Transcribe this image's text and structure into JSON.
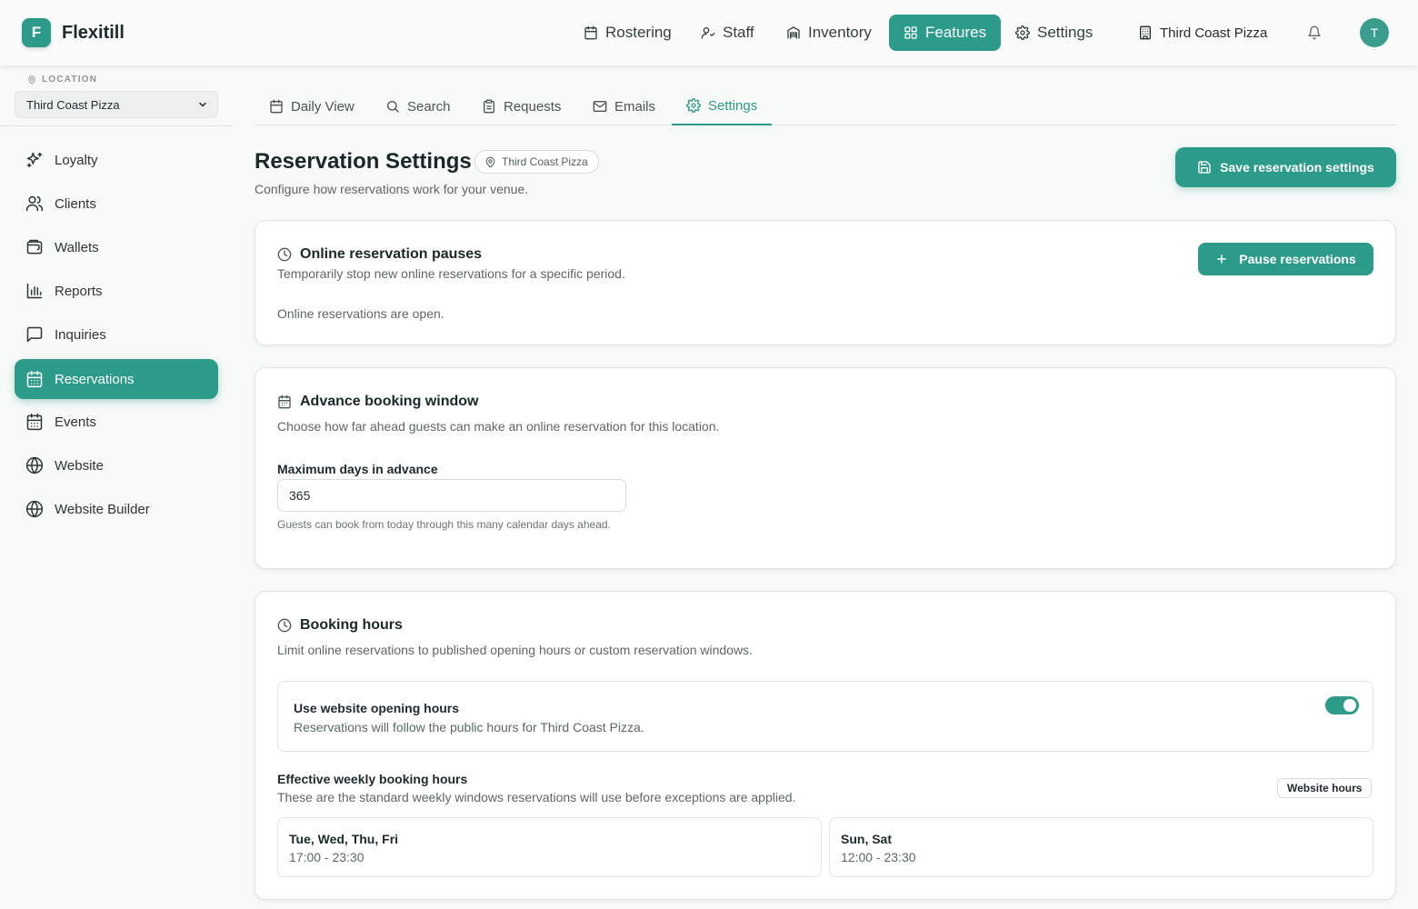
{
  "brand": {
    "logo_letter": "F",
    "name": "Flexitill"
  },
  "topnav": {
    "items": [
      {
        "label": "Rostering",
        "icon": "calendar-icon"
      },
      {
        "label": "Staff",
        "icon": "staff-icon"
      },
      {
        "label": "Inventory",
        "icon": "warehouse-icon"
      },
      {
        "label": "Features",
        "icon": "grid-icon",
        "active": true
      },
      {
        "label": "Settings",
        "icon": "gear-icon"
      }
    ],
    "venue": "Third Coast Pizza",
    "avatar_initial": "T"
  },
  "sidebar": {
    "location_label": "LOCATION",
    "location_value": "Third Coast Pizza",
    "items": [
      {
        "label": "Loyalty",
        "icon": "sparkles-icon"
      },
      {
        "label": "Clients",
        "icon": "users-icon"
      },
      {
        "label": "Wallets",
        "icon": "wallet-icon"
      },
      {
        "label": "Reports",
        "icon": "bar-chart-icon"
      },
      {
        "label": "Inquiries",
        "icon": "message-icon"
      },
      {
        "label": "Reservations",
        "icon": "calendar-days-icon",
        "active": true
      },
      {
        "label": "Events",
        "icon": "calendar-days-icon"
      },
      {
        "label": "Website",
        "icon": "globe-icon"
      },
      {
        "label": "Website Builder",
        "icon": "globe-icon"
      }
    ]
  },
  "tabs": [
    {
      "label": "Daily View",
      "icon": "calendar-icon"
    },
    {
      "label": "Search",
      "icon": "search-icon"
    },
    {
      "label": "Requests",
      "icon": "clipboard-icon"
    },
    {
      "label": "Emails",
      "icon": "mail-icon"
    },
    {
      "label": "Settings",
      "icon": "gear-icon",
      "active": true
    }
  ],
  "header": {
    "title": "Reservation Settings",
    "venue_pill": "Third Coast Pizza",
    "subtitle": "Configure how reservations work for your venue.",
    "save_label": "Save reservation settings"
  },
  "pauses": {
    "title": "Online reservation pauses",
    "description": "Temporarily stop new online reservations for a specific period.",
    "status": "Online reservations are open.",
    "button_label": "Pause reservations"
  },
  "advance": {
    "title": "Advance booking window",
    "description": "Choose how far ahead guests can make an online reservation for this location.",
    "field_label": "Maximum days in advance",
    "field_value": "365",
    "hint": "Guests can book from today through this many calendar days ahead."
  },
  "booking_hours": {
    "title": "Booking hours",
    "description": "Limit online reservations to published opening hours or custom reservation windows.",
    "toggle_title": "Use website opening hours",
    "toggle_subtitle": "Reservations will follow the public hours for Third Coast Pizza.",
    "toggle_on": true,
    "weekly_title": "Effective weekly booking hours",
    "weekly_subtitle": "These are the standard weekly windows reservations will use before exceptions are applied.",
    "badge": "Website hours",
    "windows": [
      {
        "days": "Tue, Wed, Thu, Fri",
        "hours": "17:00 - 23:30"
      },
      {
        "days": "Sun, Sat",
        "hours": "12:00 - 23:30"
      }
    ]
  },
  "colors": {
    "accent": "#2d9b8a",
    "background": "#f8f9f9",
    "text": "#1d2a2a"
  }
}
